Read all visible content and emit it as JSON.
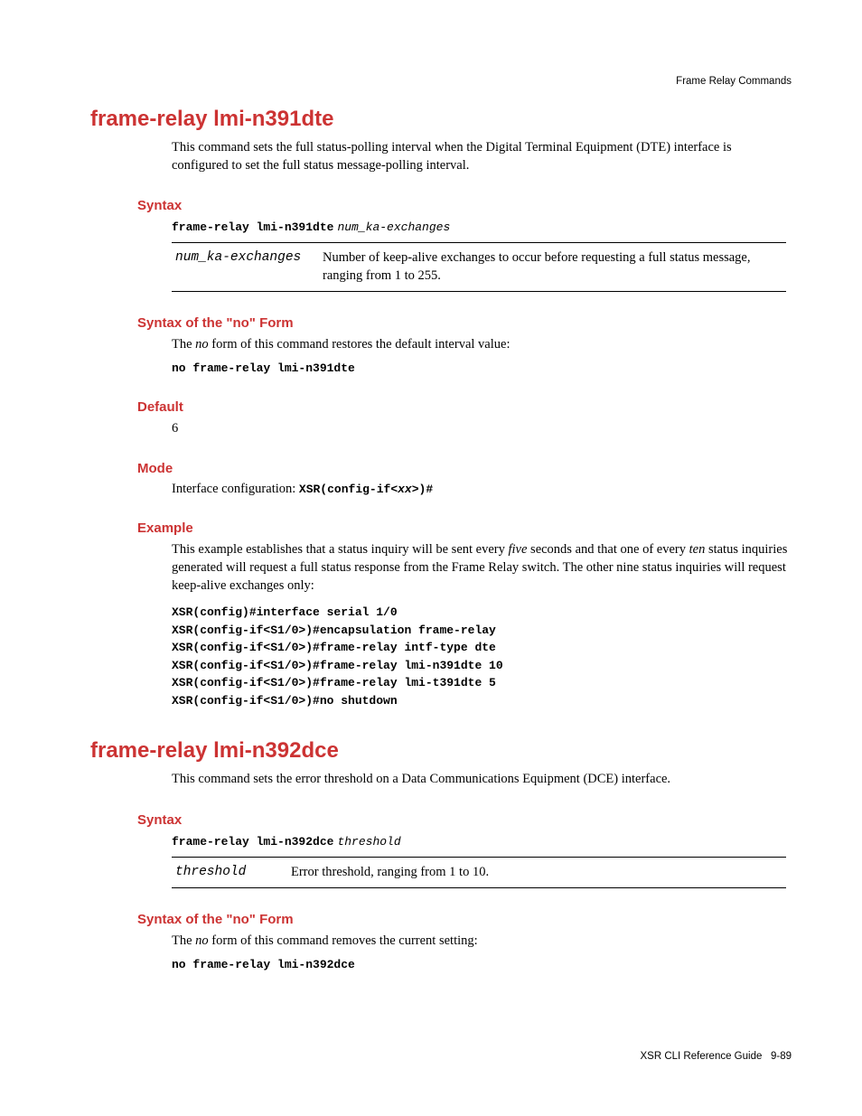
{
  "header": {
    "running": "Frame Relay Commands"
  },
  "footer": {
    "book": "XSR CLI Reference Guide",
    "page": "9-89"
  },
  "labels": {
    "syntax": "Syntax",
    "syntax_no": "Syntax of the \"no\" Form",
    "default": "Default",
    "mode": "Mode",
    "example": "Example"
  },
  "cmd1": {
    "title": "frame-relay lmi-n391dte",
    "desc": "This command sets the full status-polling interval when the Digital Terminal Equipment (DTE) interface is configured to set the full status message-polling interval.",
    "syntax_cmd": "frame-relay lmi-n391dte",
    "syntax_arg": "num_ka-exchanges",
    "param_name": "num_ka-exchanges",
    "param_desc": "Number of keep-alive exchanges to occur before requesting a full status message, ranging from 1 to 255.",
    "no_prefix": "The ",
    "no_word": "no",
    "no_suffix": " form of this command restores the default interval value:",
    "no_cmd": "no frame-relay lmi-n391dte",
    "default": "6",
    "mode_prefix": "Interface configuration: ",
    "mode_code_a": "XSR(config-if<",
    "mode_code_x": "xx",
    "mode_code_b": ">)#",
    "example_p1": "This example establishes that a status inquiry will be sent every ",
    "example_w1": "five",
    "example_p2": " seconds and that one of every ",
    "example_w2": "ten",
    "example_p3": " status inquiries generated will request a full status response from the Frame Relay switch. The other nine status inquiries will request keep-alive exchanges only:",
    "example_code": "XSR(config)#interface serial 1/0\nXSR(config-if<S1/0>)#encapsulation frame-relay\nXSR(config-if<S1/0>)#frame-relay intf-type dte\nXSR(config-if<S1/0>)#frame-relay lmi-n391dte 10\nXSR(config-if<S1/0>)#frame-relay lmi-t391dte 5\nXSR(config-if<S1/0>)#no shutdown"
  },
  "cmd2": {
    "title": "frame-relay lmi-n392dce",
    "desc": "This command sets the error threshold on a Data Communications Equipment (DCE) interface.",
    "syntax_cmd": "frame-relay lmi-n392dce",
    "syntax_arg": "threshold",
    "param_name": "threshold",
    "param_desc": "Error threshold, ranging from 1 to 10.",
    "no_prefix": "The ",
    "no_word": "no",
    "no_suffix": " form of this command removes the current setting:",
    "no_cmd": "no frame-relay lmi-n392dce"
  }
}
